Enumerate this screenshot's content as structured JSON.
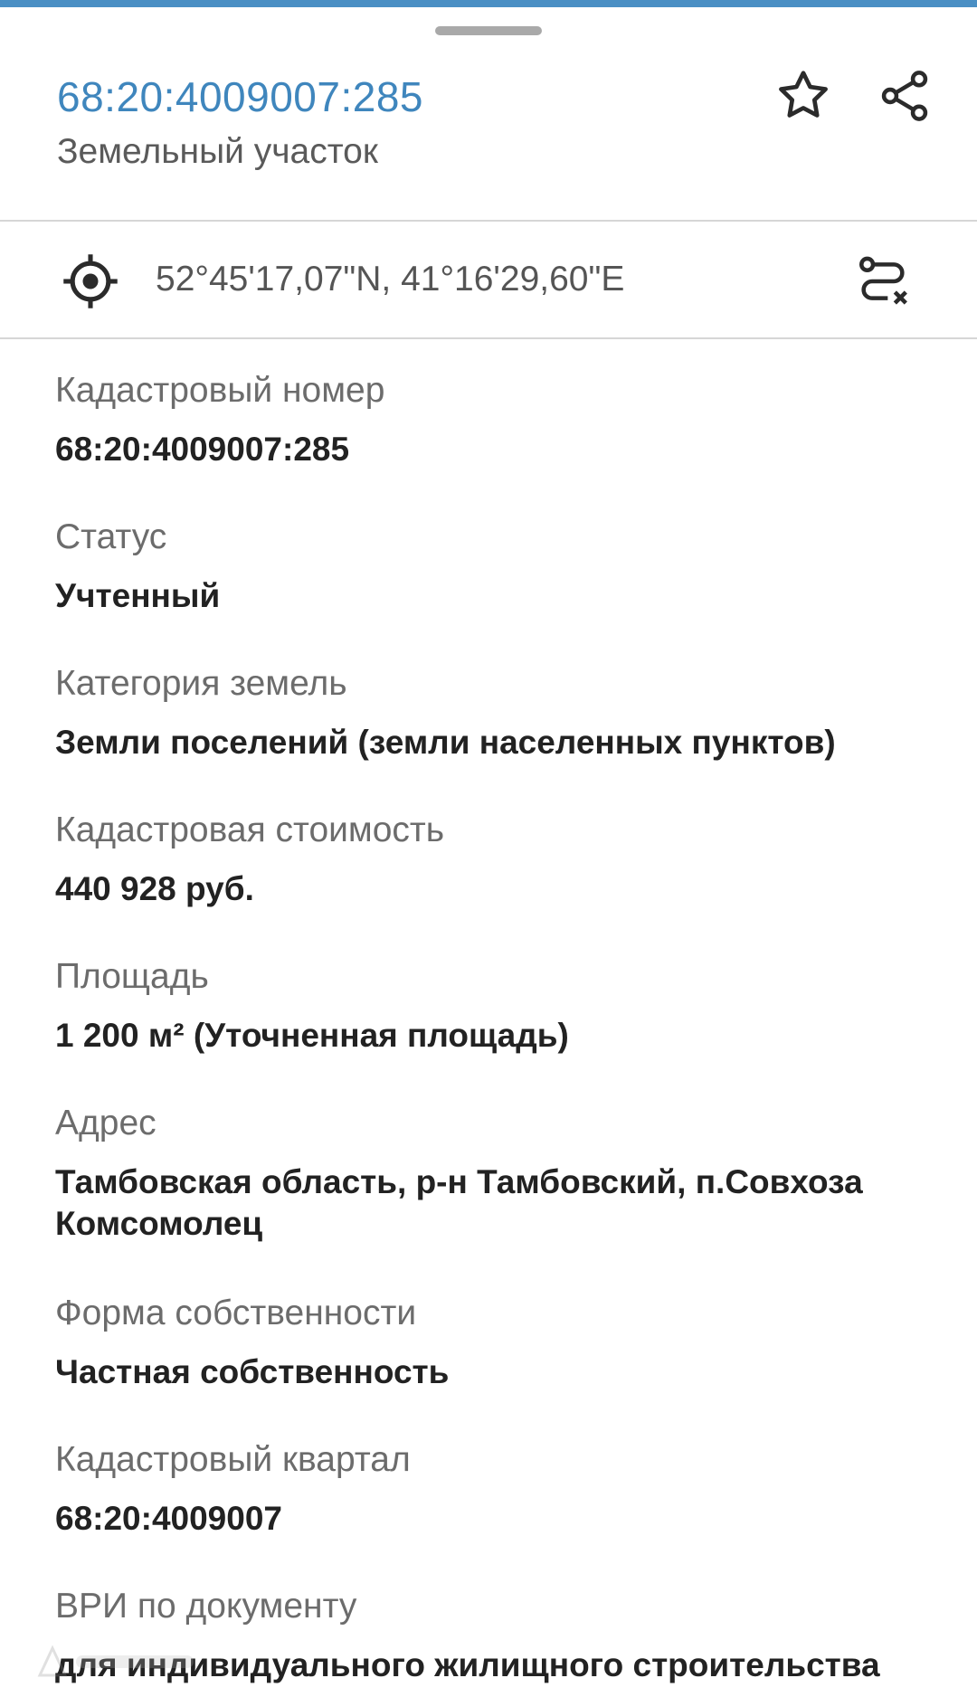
{
  "header": {
    "cadastral_number": "68:20:4009007:285",
    "object_type": "Земельный участок"
  },
  "icons": {
    "favorite": "star-icon",
    "share": "share-icon",
    "locate": "crosshair-icon",
    "route": "route-icon"
  },
  "location": {
    "coordinates": "52°45'17,07\"N, 41°16'29,60\"E"
  },
  "fields": [
    {
      "label": "Кадастровый номер",
      "value": "68:20:4009007:285"
    },
    {
      "label": "Статус",
      "value": "Учтенный"
    },
    {
      "label": "Категория земель",
      "value": "Земли поселений (земли населенных пунктов)"
    },
    {
      "label": "Кадастровая стоимость",
      "value": "440 928 руб."
    },
    {
      "label": "Площадь",
      "value": "1 200 м² (Уточненная площадь)"
    },
    {
      "label": "Адрес",
      "value": "Тамбовская область, р-н Тамбовский, п.Совхоза Комсомолец"
    },
    {
      "label": "Форма собственности",
      "value": "Частная собственность"
    },
    {
      "label": "Кадастровый квартал",
      "value": "68:20:4009007"
    },
    {
      "label": "ВРИ по документу",
      "value": "для индивидуального жилищного строительства"
    }
  ],
  "colors": {
    "accent": "#3f86bd",
    "top_bar": "#4a8fc4",
    "label": "#6c6c6c",
    "value": "#222222",
    "divider": "#d6d6d6"
  }
}
